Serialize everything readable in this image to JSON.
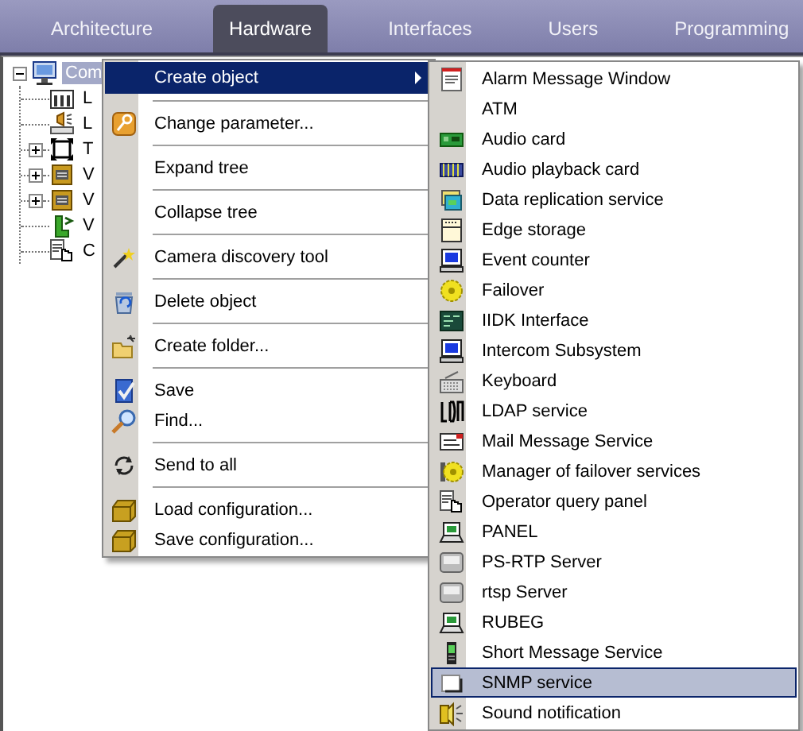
{
  "tabs": [
    {
      "label": "Architecture",
      "selected": false
    },
    {
      "label": "Hardware",
      "selected": true
    },
    {
      "label": "Interfaces",
      "selected": false
    },
    {
      "label": "Users",
      "selected": false
    },
    {
      "label": "Programming",
      "selected": false
    }
  ],
  "tree": {
    "label": "Com",
    "kind": "node",
    "expanded": true,
    "selected": true,
    "children": [
      {
        "label": "L",
        "kind": "leaf"
      },
      {
        "label": "L",
        "kind": "leaf"
      },
      {
        "label": "T",
        "kind": "node",
        "expanded": false
      },
      {
        "label": "V",
        "kind": "node",
        "expanded": false
      },
      {
        "label": "V",
        "kind": "node",
        "expanded": false
      },
      {
        "label": "V",
        "kind": "leaf"
      },
      {
        "label": "C",
        "kind": "leaf"
      }
    ]
  },
  "context_menu": {
    "groups": [
      {
        "items": [
          {
            "label": "Create object",
            "submenu": true,
            "selected": true
          }
        ]
      },
      {
        "items": [
          {
            "label": "Change parameter...",
            "selected": false
          }
        ]
      },
      {
        "items": [
          {
            "label": "Expand tree",
            "selected": false
          }
        ]
      },
      {
        "items": [
          {
            "label": "Collapse tree",
            "selected": false
          }
        ]
      },
      {
        "items": [
          {
            "label": "Camera discovery tool",
            "selected": false
          }
        ]
      },
      {
        "items": [
          {
            "label": "Delete object",
            "selected": false
          }
        ]
      },
      {
        "items": [
          {
            "label": "Create folder...",
            "selected": false
          }
        ]
      },
      {
        "items": [
          {
            "label": "Save",
            "selected": false
          },
          {
            "label": "Find...",
            "selected": false
          }
        ]
      },
      {
        "items": [
          {
            "label": "Send to all",
            "selected": false
          }
        ]
      },
      {
        "items": [
          {
            "label": "Load configuration...",
            "selected": false
          },
          {
            "label": "Save configuration...",
            "selected": false
          }
        ]
      }
    ]
  },
  "submenu": {
    "items": [
      {
        "label": "Alarm Message Window",
        "selected": false
      },
      {
        "label": "ATM",
        "selected": false
      },
      {
        "label": "Audio card",
        "selected": false
      },
      {
        "label": "Audio playback card",
        "selected": false
      },
      {
        "label": "Data replication service",
        "selected": false
      },
      {
        "label": "Edge storage",
        "selected": false
      },
      {
        "label": "Event counter",
        "selected": false
      },
      {
        "label": "Failover",
        "selected": false
      },
      {
        "label": "IIDK Interface",
        "selected": false
      },
      {
        "label": "Intercom Subsystem",
        "selected": false
      },
      {
        "label": "Keyboard",
        "selected": false
      },
      {
        "label": "LDAP service",
        "selected": false
      },
      {
        "label": "Mail Message Service",
        "selected": false
      },
      {
        "label": "Manager of failover services",
        "selected": false
      },
      {
        "label": "Operator query panel",
        "selected": false
      },
      {
        "label": "PANEL",
        "selected": false
      },
      {
        "label": "PS-RTP Server",
        "selected": false
      },
      {
        "label": "rtsp Server",
        "selected": false
      },
      {
        "label": "RUBEG",
        "selected": false
      },
      {
        "label": "Short Message Service",
        "selected": false
      },
      {
        "label": "SNMP service",
        "selected": true
      },
      {
        "label": "Sound notification",
        "selected": false
      }
    ]
  }
}
